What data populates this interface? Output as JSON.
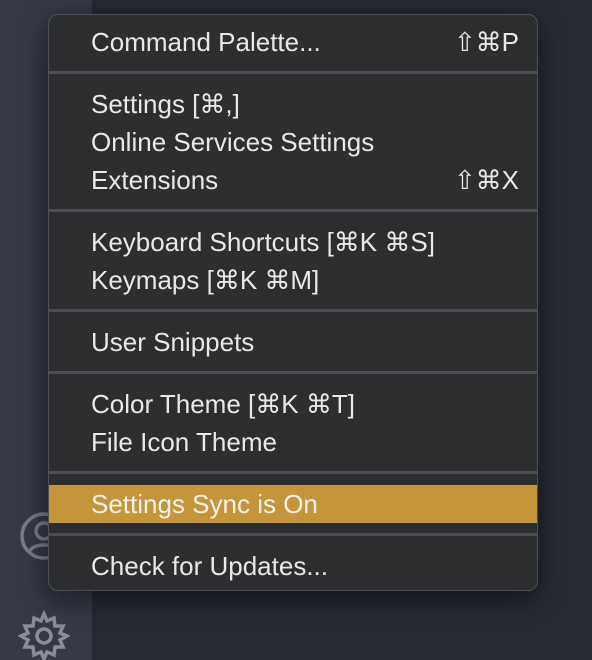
{
  "theme": {
    "menu_background": "#2d2e30",
    "active_item_background": "#c4953a",
    "activity_bar_background": "#363a47",
    "editor_background": "#262a33"
  },
  "activity_bar": {
    "icons": [
      "accounts-icon",
      "gear-icon"
    ]
  },
  "menu": {
    "items": [
      {
        "label": "Command Palette...",
        "shortcut": "⇧⌘P"
      },
      {
        "label": "Settings [⌘,]",
        "shortcut": ""
      },
      {
        "label": "Online Services Settings",
        "shortcut": ""
      },
      {
        "label": "Extensions",
        "shortcut": "⇧⌘X"
      },
      {
        "label": "Keyboard Shortcuts [⌘K ⌘S]",
        "shortcut": ""
      },
      {
        "label": "Keymaps [⌘K ⌘M]",
        "shortcut": ""
      },
      {
        "label": "User Snippets",
        "shortcut": ""
      },
      {
        "label": "Color Theme [⌘K ⌘T]",
        "shortcut": ""
      },
      {
        "label": "File Icon Theme",
        "shortcut": ""
      },
      {
        "label": "Settings Sync is On",
        "shortcut": "",
        "highlighted": true
      },
      {
        "label": "Check for Updates...",
        "shortcut": ""
      }
    ]
  }
}
